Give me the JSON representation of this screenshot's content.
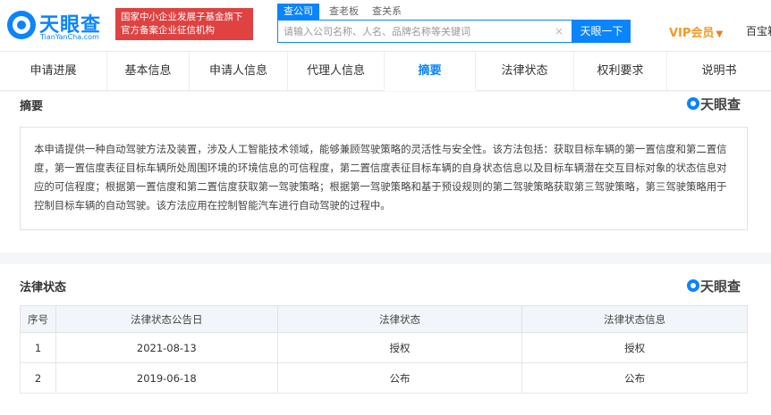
{
  "header": {
    "logo_text": "天眼查",
    "logo_sub": "TianYanCha.com",
    "badge_line1": "国家中小企业发展子基金旗下",
    "badge_line2": "官方备案企业征信机构",
    "search_tabs": [
      "查公司",
      "查老板",
      "查关系"
    ],
    "search_placeholder": "请输入公司名称、人名、品牌名称等关键词",
    "search_button": "天眼一下",
    "vip_label": "VIP会员",
    "right_text": "百宝箱"
  },
  "tabs": [
    "申请进展",
    "基本信息",
    "申请人信息",
    "代理人信息",
    "摘要",
    "法律状态",
    "权利要求",
    "说明书"
  ],
  "active_tab": "摘要",
  "abstract": {
    "title": "摘要",
    "watermark": "天眼查",
    "text": "本申请提供一种自动驾驶方法及装置，涉及人工智能技术领域，能够兼顾驾驶策略的灵活性与安全性。该方法包括：获取目标车辆的第一置信度和第二置信度，第一置信度表征目标车辆所处周围环境的环境信息的可信程度，第二置信度表征目标车辆的自身状态信息以及目标车辆潜在交互目标对象的状态信息对应的可信程度；根据第一置信度和第二置信度获取第一驾驶策略；根据第一驾驶策略和基于预设规则的第二驾驶策略获取第三驾驶策略，第三驾驶策略用于控制目标车辆的自动驾驶。该方法应用在控制智能汽车进行自动驾驶的过程中。"
  },
  "legal": {
    "title": "法律状态",
    "watermark": "天眼查",
    "columns": [
      "序号",
      "法律状态公告日",
      "法律状态",
      "法律状态信息"
    ],
    "rows": [
      {
        "no": "1",
        "date": "2021-08-13",
        "status": "授权",
        "info": "授权"
      },
      {
        "no": "2",
        "date": "2019-06-18",
        "status": "公布",
        "info": "公布"
      }
    ]
  }
}
